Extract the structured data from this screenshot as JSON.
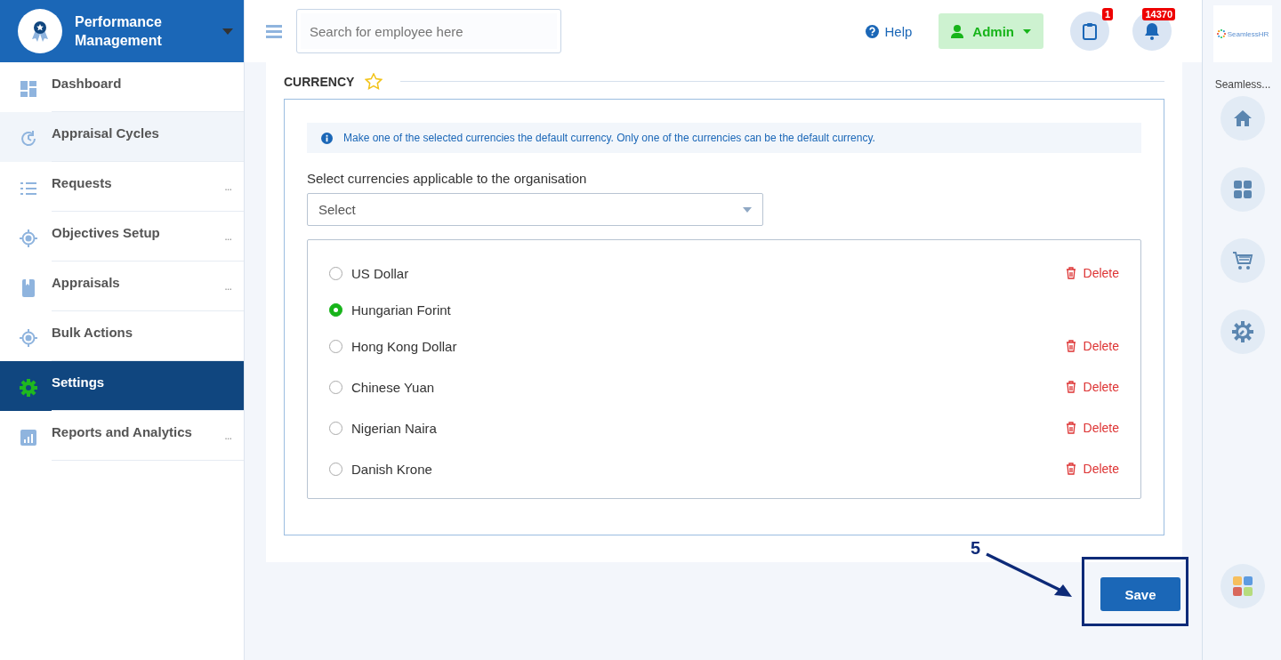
{
  "sidebar": {
    "title": "Performance Management",
    "items": [
      {
        "label": "Dashboard",
        "kind": "dashboard",
        "selected": false,
        "highlighted": false
      },
      {
        "label": "Appraisal Cycles",
        "kind": "cycle",
        "selected": false,
        "highlighted": true
      },
      {
        "label": "Requests",
        "kind": "list",
        "selected": false,
        "highlighted": false,
        "more": "..."
      },
      {
        "label": "Objectives Setup",
        "kind": "target",
        "selected": false,
        "highlighted": false,
        "more": "..."
      },
      {
        "label": "Appraisals",
        "kind": "book",
        "selected": false,
        "highlighted": false,
        "more": "..."
      },
      {
        "label": "Bulk Actions",
        "kind": "target",
        "selected": false,
        "highlighted": false
      },
      {
        "label": "Settings",
        "kind": "gear",
        "selected": true,
        "highlighted": false
      },
      {
        "label": "Reports and Analytics",
        "kind": "chart",
        "selected": false,
        "highlighted": false,
        "more": "..."
      }
    ]
  },
  "header": {
    "search": {
      "placeholder": "Search for employee here"
    },
    "help": "Help",
    "user": "Admin",
    "tasks_badge": "1",
    "notifications_badge": "14370"
  },
  "section": {
    "title": "CURRENCY",
    "info": "Make one of the selected currencies the default currency. Only one of the currencies can be the default currency.",
    "select_label": "Select currencies applicable to the organisation",
    "select": {
      "placeholder": "Select"
    },
    "currencies": [
      {
        "name": "US Dollar",
        "selected": false,
        "delete": "Delete"
      },
      {
        "name": "Hungarian Forint",
        "selected": true
      },
      {
        "name": "Hong Kong Dollar",
        "selected": false,
        "delete": "Delete"
      },
      {
        "name": "Chinese Yuan",
        "selected": false,
        "delete": "Delete"
      },
      {
        "name": "Nigerian Naira",
        "selected": false,
        "delete": "Delete"
      },
      {
        "name": "Danish Krone",
        "selected": false,
        "delete": "Delete"
      }
    ]
  },
  "save": "Save",
  "annotation": {
    "step": "5"
  },
  "rail": {
    "logo": "SeamlessHR",
    "label": "Seamless...",
    "items": [
      {
        "kind": "home"
      },
      {
        "kind": "grid"
      },
      {
        "kind": "cart"
      },
      {
        "kind": "wrench"
      },
      {
        "kind": "apps"
      }
    ]
  }
}
